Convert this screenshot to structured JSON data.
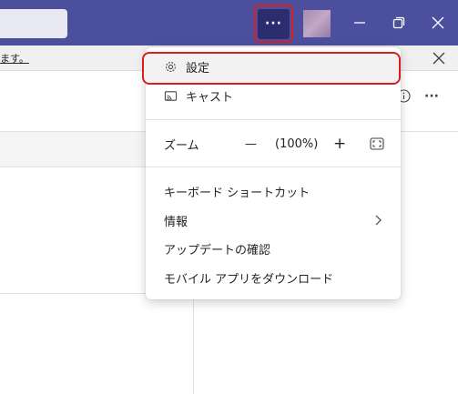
{
  "notice": {
    "text": "ます。"
  },
  "titlebar": {
    "more_label": "···"
  },
  "menu": {
    "settings": "設定",
    "cast": "キャスト",
    "zoom": {
      "label": "ズーム",
      "minus": "—",
      "value": "(100%)",
      "plus": "+"
    },
    "shortcuts": "キーボード ショートカット",
    "about": "情報",
    "updates": "アップデートの確認",
    "download": "モバイル アプリをダウンロード"
  },
  "toolbar": {
    "more_label": "···"
  },
  "icons": {
    "settings": "gear-icon",
    "cast": "cast-icon",
    "fullscreen": "fullscreen-icon",
    "about_chevron": "chevron-right-icon",
    "minimize": "minimize-icon",
    "maximize": "maximize-icon",
    "close": "close-icon"
  },
  "colors": {
    "titlebar": "#4b4f9e",
    "highlight_border": "#d61f1f",
    "more_button": "#2b2d6e"
  }
}
